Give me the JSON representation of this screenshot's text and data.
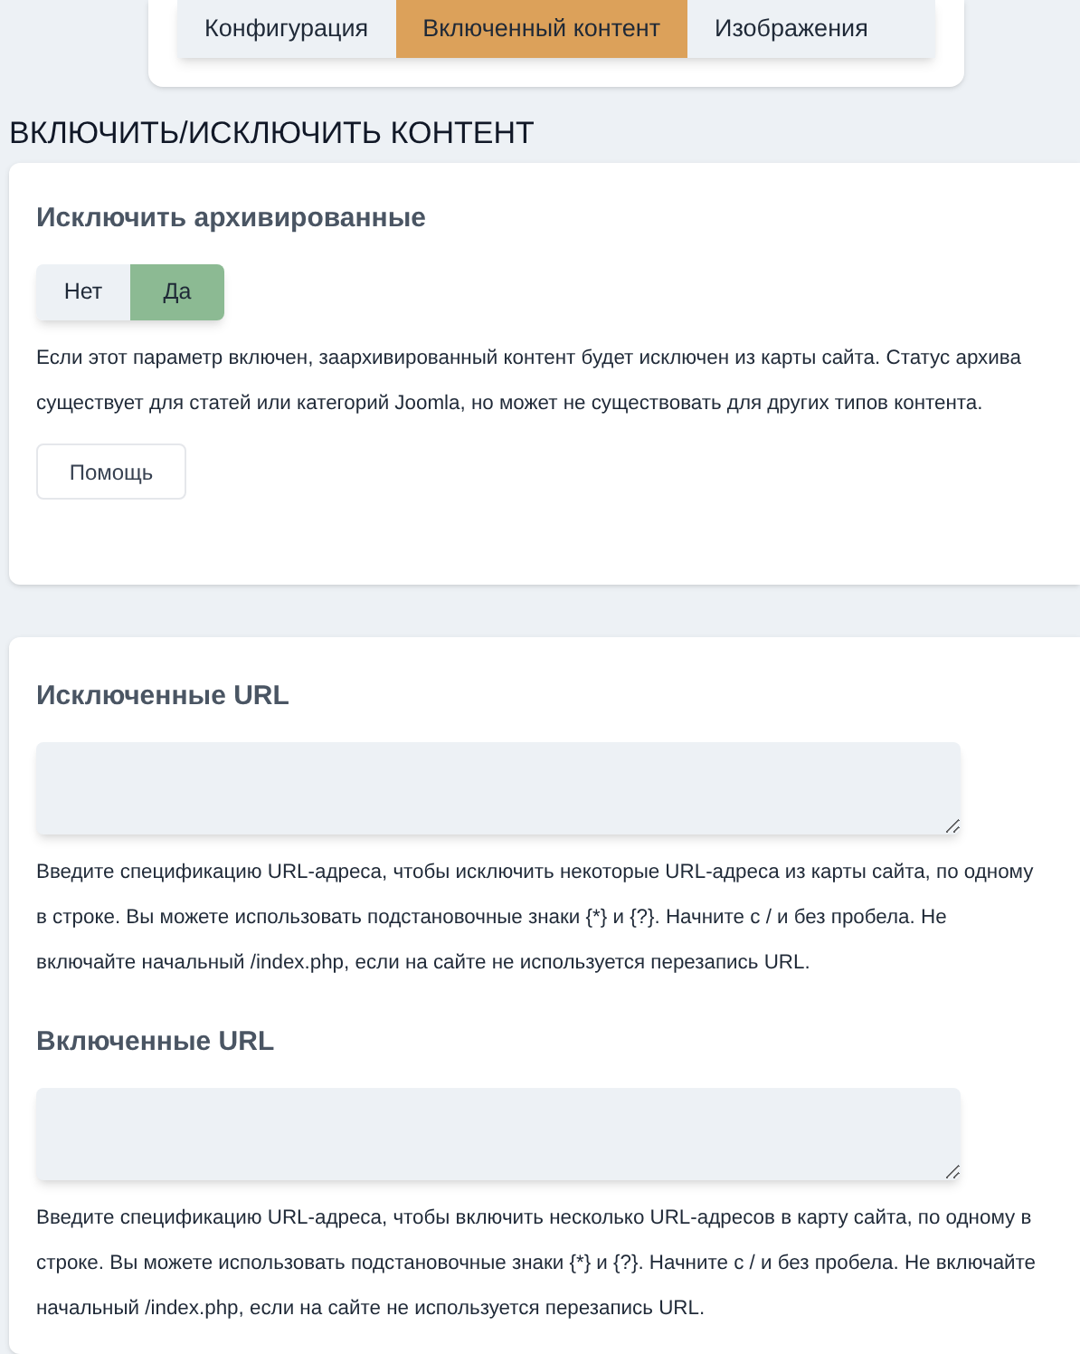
{
  "tabs": [
    {
      "label": "Конфигурация",
      "selected": false
    },
    {
      "label": "Включенный контент",
      "selected": true
    },
    {
      "label": "Изображения",
      "selected": false
    }
  ],
  "heading": "ВКЛЮЧИТЬ/ИСКЛЮЧИТЬ КОНТЕНТ",
  "cards": [
    {
      "kind": "toggle",
      "title": "Исключить архивированные",
      "options": [
        {
          "label": "Нет",
          "selected": false
        },
        {
          "label": "Да",
          "selected": true
        }
      ],
      "description": "Если этот параметр включен, заархивированный контент будет исключен из карты сайта. Статус архива существует для статей или категорий Joomla, но может не существовать для других типов контента.",
      "help": "Помощь"
    },
    {
      "kind": "textareas",
      "fields": [
        {
          "title": "Исключенные URL",
          "description": "Введите спецификацию URL-адреса, чтобы исключить некоторые URL-адреса из карты сайта, по одному в строке. Вы можете использовать подстановочные знаки {*} и {?}. Начните с / и без пробела. Не включайте начальный /index.php, если на сайте не используется перезапись URL."
        },
        {
          "title": "Включенные URL",
          "description": "Введите спецификацию URL-адреса, чтобы включить несколько URL-адресов в карту сайта, по одному в строке. Вы можете использовать подстановочные знаки {*} и {?}. Начните с / и без пробела. Не включайте начальный /index.php, если на сайте не используется перезапись URL."
        }
      ]
    }
  ]
}
